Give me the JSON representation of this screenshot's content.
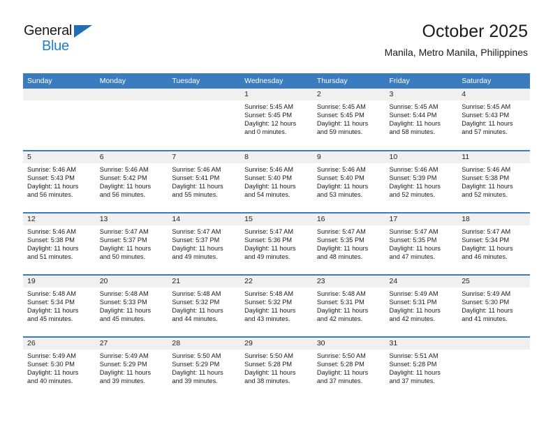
{
  "brand": {
    "name_top": "General",
    "name_bottom": "Blue",
    "triangle_color": "#1f6fb2",
    "blue_color": "#1f7fd0"
  },
  "header": {
    "title": "October 2025",
    "subtitle": "Manila, Metro Manila, Philippines"
  },
  "colors": {
    "header_band": "#3b7cbf",
    "daynum_band": "#f0f0f0",
    "cell_bg": "#ffffff",
    "text": "#1a1a1a"
  },
  "weekdays": [
    "Sunday",
    "Monday",
    "Tuesday",
    "Wednesday",
    "Thursday",
    "Friday",
    "Saturday"
  ],
  "weeks": [
    [
      {
        "day": "",
        "blank": true
      },
      {
        "day": "",
        "blank": true
      },
      {
        "day": "",
        "blank": true
      },
      {
        "day": "1",
        "sunrise": "Sunrise: 5:45 AM",
        "sunset": "Sunset: 5:45 PM",
        "daylight_1": "Daylight: 12 hours",
        "daylight_2": "and 0 minutes."
      },
      {
        "day": "2",
        "sunrise": "Sunrise: 5:45 AM",
        "sunset": "Sunset: 5:45 PM",
        "daylight_1": "Daylight: 11 hours",
        "daylight_2": "and 59 minutes."
      },
      {
        "day": "3",
        "sunrise": "Sunrise: 5:45 AM",
        "sunset": "Sunset: 5:44 PM",
        "daylight_1": "Daylight: 11 hours",
        "daylight_2": "and 58 minutes."
      },
      {
        "day": "4",
        "sunrise": "Sunrise: 5:45 AM",
        "sunset": "Sunset: 5:43 PM",
        "daylight_1": "Daylight: 11 hours",
        "daylight_2": "and 57 minutes."
      }
    ],
    [
      {
        "day": "5",
        "sunrise": "Sunrise: 5:46 AM",
        "sunset": "Sunset: 5:43 PM",
        "daylight_1": "Daylight: 11 hours",
        "daylight_2": "and 56 minutes."
      },
      {
        "day": "6",
        "sunrise": "Sunrise: 5:46 AM",
        "sunset": "Sunset: 5:42 PM",
        "daylight_1": "Daylight: 11 hours",
        "daylight_2": "and 56 minutes."
      },
      {
        "day": "7",
        "sunrise": "Sunrise: 5:46 AM",
        "sunset": "Sunset: 5:41 PM",
        "daylight_1": "Daylight: 11 hours",
        "daylight_2": "and 55 minutes."
      },
      {
        "day": "8",
        "sunrise": "Sunrise: 5:46 AM",
        "sunset": "Sunset: 5:40 PM",
        "daylight_1": "Daylight: 11 hours",
        "daylight_2": "and 54 minutes."
      },
      {
        "day": "9",
        "sunrise": "Sunrise: 5:46 AM",
        "sunset": "Sunset: 5:40 PM",
        "daylight_1": "Daylight: 11 hours",
        "daylight_2": "and 53 minutes."
      },
      {
        "day": "10",
        "sunrise": "Sunrise: 5:46 AM",
        "sunset": "Sunset: 5:39 PM",
        "daylight_1": "Daylight: 11 hours",
        "daylight_2": "and 52 minutes."
      },
      {
        "day": "11",
        "sunrise": "Sunrise: 5:46 AM",
        "sunset": "Sunset: 5:38 PM",
        "daylight_1": "Daylight: 11 hours",
        "daylight_2": "and 52 minutes."
      }
    ],
    [
      {
        "day": "12",
        "sunrise": "Sunrise: 5:46 AM",
        "sunset": "Sunset: 5:38 PM",
        "daylight_1": "Daylight: 11 hours",
        "daylight_2": "and 51 minutes."
      },
      {
        "day": "13",
        "sunrise": "Sunrise: 5:47 AM",
        "sunset": "Sunset: 5:37 PM",
        "daylight_1": "Daylight: 11 hours",
        "daylight_2": "and 50 minutes."
      },
      {
        "day": "14",
        "sunrise": "Sunrise: 5:47 AM",
        "sunset": "Sunset: 5:37 PM",
        "daylight_1": "Daylight: 11 hours",
        "daylight_2": "and 49 minutes."
      },
      {
        "day": "15",
        "sunrise": "Sunrise: 5:47 AM",
        "sunset": "Sunset: 5:36 PM",
        "daylight_1": "Daylight: 11 hours",
        "daylight_2": "and 49 minutes."
      },
      {
        "day": "16",
        "sunrise": "Sunrise: 5:47 AM",
        "sunset": "Sunset: 5:35 PM",
        "daylight_1": "Daylight: 11 hours",
        "daylight_2": "and 48 minutes."
      },
      {
        "day": "17",
        "sunrise": "Sunrise: 5:47 AM",
        "sunset": "Sunset: 5:35 PM",
        "daylight_1": "Daylight: 11 hours",
        "daylight_2": "and 47 minutes."
      },
      {
        "day": "18",
        "sunrise": "Sunrise: 5:47 AM",
        "sunset": "Sunset: 5:34 PM",
        "daylight_1": "Daylight: 11 hours",
        "daylight_2": "and 46 minutes."
      }
    ],
    [
      {
        "day": "19",
        "sunrise": "Sunrise: 5:48 AM",
        "sunset": "Sunset: 5:34 PM",
        "daylight_1": "Daylight: 11 hours",
        "daylight_2": "and 45 minutes."
      },
      {
        "day": "20",
        "sunrise": "Sunrise: 5:48 AM",
        "sunset": "Sunset: 5:33 PM",
        "daylight_1": "Daylight: 11 hours",
        "daylight_2": "and 45 minutes."
      },
      {
        "day": "21",
        "sunrise": "Sunrise: 5:48 AM",
        "sunset": "Sunset: 5:32 PM",
        "daylight_1": "Daylight: 11 hours",
        "daylight_2": "and 44 minutes."
      },
      {
        "day": "22",
        "sunrise": "Sunrise: 5:48 AM",
        "sunset": "Sunset: 5:32 PM",
        "daylight_1": "Daylight: 11 hours",
        "daylight_2": "and 43 minutes."
      },
      {
        "day": "23",
        "sunrise": "Sunrise: 5:48 AM",
        "sunset": "Sunset: 5:31 PM",
        "daylight_1": "Daylight: 11 hours",
        "daylight_2": "and 42 minutes."
      },
      {
        "day": "24",
        "sunrise": "Sunrise: 5:49 AM",
        "sunset": "Sunset: 5:31 PM",
        "daylight_1": "Daylight: 11 hours",
        "daylight_2": "and 42 minutes."
      },
      {
        "day": "25",
        "sunrise": "Sunrise: 5:49 AM",
        "sunset": "Sunset: 5:30 PM",
        "daylight_1": "Daylight: 11 hours",
        "daylight_2": "and 41 minutes."
      }
    ],
    [
      {
        "day": "26",
        "sunrise": "Sunrise: 5:49 AM",
        "sunset": "Sunset: 5:30 PM",
        "daylight_1": "Daylight: 11 hours",
        "daylight_2": "and 40 minutes."
      },
      {
        "day": "27",
        "sunrise": "Sunrise: 5:49 AM",
        "sunset": "Sunset: 5:29 PM",
        "daylight_1": "Daylight: 11 hours",
        "daylight_2": "and 39 minutes."
      },
      {
        "day": "28",
        "sunrise": "Sunrise: 5:50 AM",
        "sunset": "Sunset: 5:29 PM",
        "daylight_1": "Daylight: 11 hours",
        "daylight_2": "and 39 minutes."
      },
      {
        "day": "29",
        "sunrise": "Sunrise: 5:50 AM",
        "sunset": "Sunset: 5:28 PM",
        "daylight_1": "Daylight: 11 hours",
        "daylight_2": "and 38 minutes."
      },
      {
        "day": "30",
        "sunrise": "Sunrise: 5:50 AM",
        "sunset": "Sunset: 5:28 PM",
        "daylight_1": "Daylight: 11 hours",
        "daylight_2": "and 37 minutes."
      },
      {
        "day": "31",
        "sunrise": "Sunrise: 5:51 AM",
        "sunset": "Sunset: 5:28 PM",
        "daylight_1": "Daylight: 11 hours",
        "daylight_2": "and 37 minutes."
      },
      {
        "day": "",
        "blank": true
      }
    ]
  ]
}
